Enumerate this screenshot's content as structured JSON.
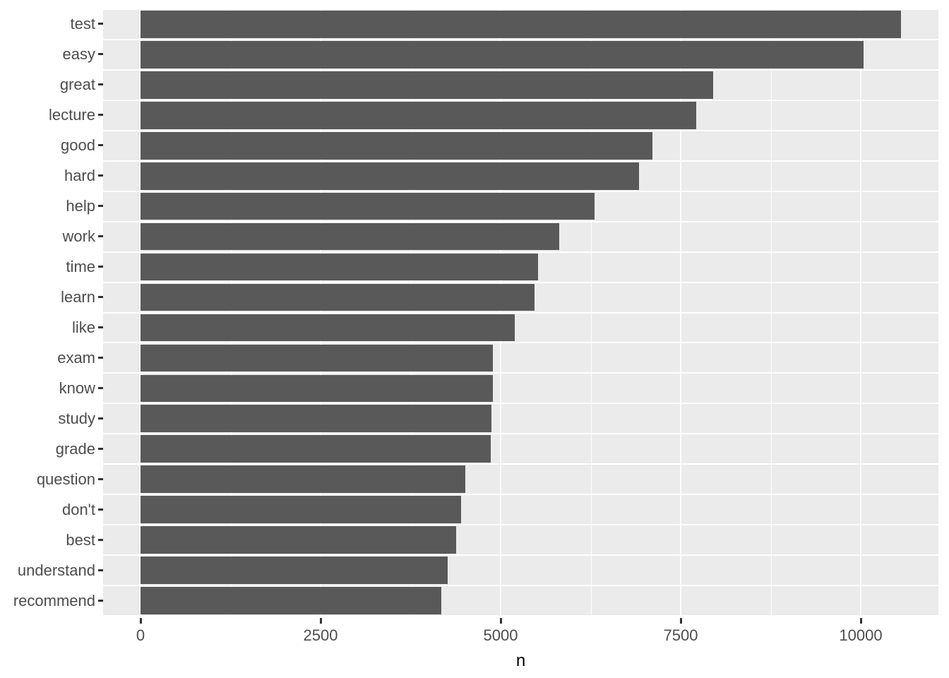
{
  "chart_data": {
    "type": "bar",
    "orientation": "horizontal",
    "title": "",
    "subtitle": "",
    "xlabel": "n",
    "ylabel": "",
    "xlim": [
      0,
      11080
    ],
    "x_ticks": [
      0,
      2500,
      5000,
      7500,
      10000
    ],
    "x_tick_labels": [
      "0",
      "2500",
      "5000",
      "7500",
      "10000"
    ],
    "x_minor_ticks": [
      1250,
      3750,
      6250,
      8750
    ],
    "grid": true,
    "legend": null,
    "bar_color": "#595959",
    "panel_background": "#EBEBEB",
    "gridline_color": "#FFFFFF",
    "categories": [
      "test",
      "easy",
      "great",
      "lecture",
      "good",
      "hard",
      "help",
      "work",
      "time",
      "learn",
      "like",
      "exam",
      "know",
      "study",
      "grade",
      "question",
      "don't",
      "best",
      "understand",
      "recommend"
    ],
    "values": [
      10556,
      10039,
      7951,
      7716,
      7105,
      6922,
      6304,
      5811,
      5517,
      5468,
      5196,
      4892,
      4892,
      4873,
      4863,
      4510,
      4451,
      4382,
      4265,
      4176
    ]
  }
}
